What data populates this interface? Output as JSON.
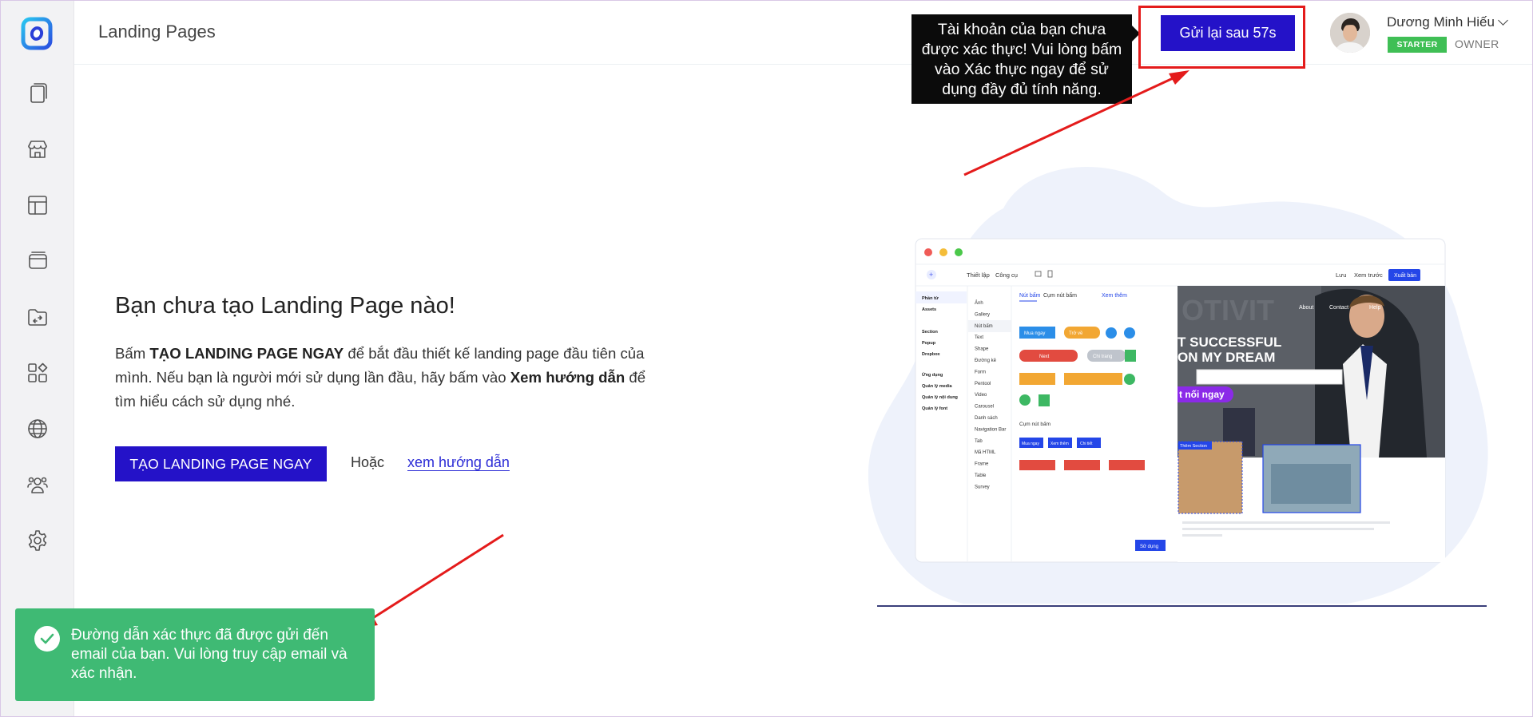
{
  "header": {
    "page_title": "Landing Pages",
    "resend_button_label": "Gửi lại sau 57s",
    "tooltip_text": "Tài khoản của bạn chưa được xác thực! Vui lòng bấm vào Xác thực ngay để sử dụng đầy đủ tính năng.",
    "user": {
      "name": "Dương Minh Hiếu",
      "plan": "STARTER",
      "role": "OWNER"
    }
  },
  "sidebar": {
    "items": [
      {
        "icon": "pages-icon"
      },
      {
        "icon": "store-icon"
      },
      {
        "icon": "template-icon"
      },
      {
        "icon": "popup-icon"
      },
      {
        "icon": "folder-icon"
      },
      {
        "icon": "apps-icon"
      },
      {
        "icon": "globe-icon"
      },
      {
        "icon": "team-icon"
      },
      {
        "icon": "settings-icon"
      }
    ]
  },
  "empty_state": {
    "title": "Bạn chưa tạo Landing Page nào!",
    "desc_part1": "Bấm ",
    "desc_bold1": "TẠO LANDING PAGE NGAY",
    "desc_part2": " để bắt đầu thiết kế landing page đầu tiên của mình. Nếu bạn là người mới sử dụng lần đầu, hãy bấm vào ",
    "desc_bold2": "Xem hướng dẫn",
    "desc_part3": " để tìm hiểu cách sử dụng nhé.",
    "create_button_label": "TẠO LANDING PAGE NGAY",
    "or_text": "Hoặc",
    "guide_link_text": "xem hướng dẫn"
  },
  "illustration": {
    "toolbar_left": [
      "Thiết lập",
      "Công cụ"
    ],
    "toolbar_right": [
      "Lưu",
      "Xem trước"
    ],
    "publish_label": "Xuất bản",
    "left_menu": [
      "Phần tử",
      "Assets",
      "Section",
      "Popup",
      "Dropbox",
      "Ứng dụng",
      "Quản lý media",
      "Quản lý nội dung",
      "Quản lý font"
    ],
    "element_list": [
      "Ảnh",
      "Gallery",
      "Nút bấm",
      "Text",
      "Shape",
      "Đường kẻ",
      "Form",
      "Pentool",
      "Video",
      "Carousel",
      "Danh sách",
      "Navigation Bar",
      "Tab",
      "Mã HTML",
      "Frame",
      "Table",
      "Survey"
    ],
    "panel_tabs": [
      "Nút bấm",
      "Cụm nút bấm"
    ],
    "see_more": "Xem thêm",
    "group_label": "Cụm nút bấm",
    "use_button": "Sử dụng",
    "hero_text_1": "T SUCCESSFUL",
    "hero_text_2": "ON MY DREAM",
    "hero_nav": [
      "About",
      "Contact",
      "Help"
    ],
    "cta_text": "t nối ngay",
    "add_section": "Thêm Section",
    "sample_buttons": [
      "Mua ngay",
      "Trở về",
      "Next",
      "Chi trang",
      "Mua ngay",
      "Xem thêm",
      "Chi tiết"
    ]
  },
  "toast": {
    "message": "Đường dẫn xác thực đã được gửi đến email của bạn. Vui lòng truy cập email và xác nhận."
  },
  "colors": {
    "primary": "#2412c8",
    "success": "#3fba74",
    "badge": "#3fbf55",
    "annotation": "#e41b1b"
  }
}
